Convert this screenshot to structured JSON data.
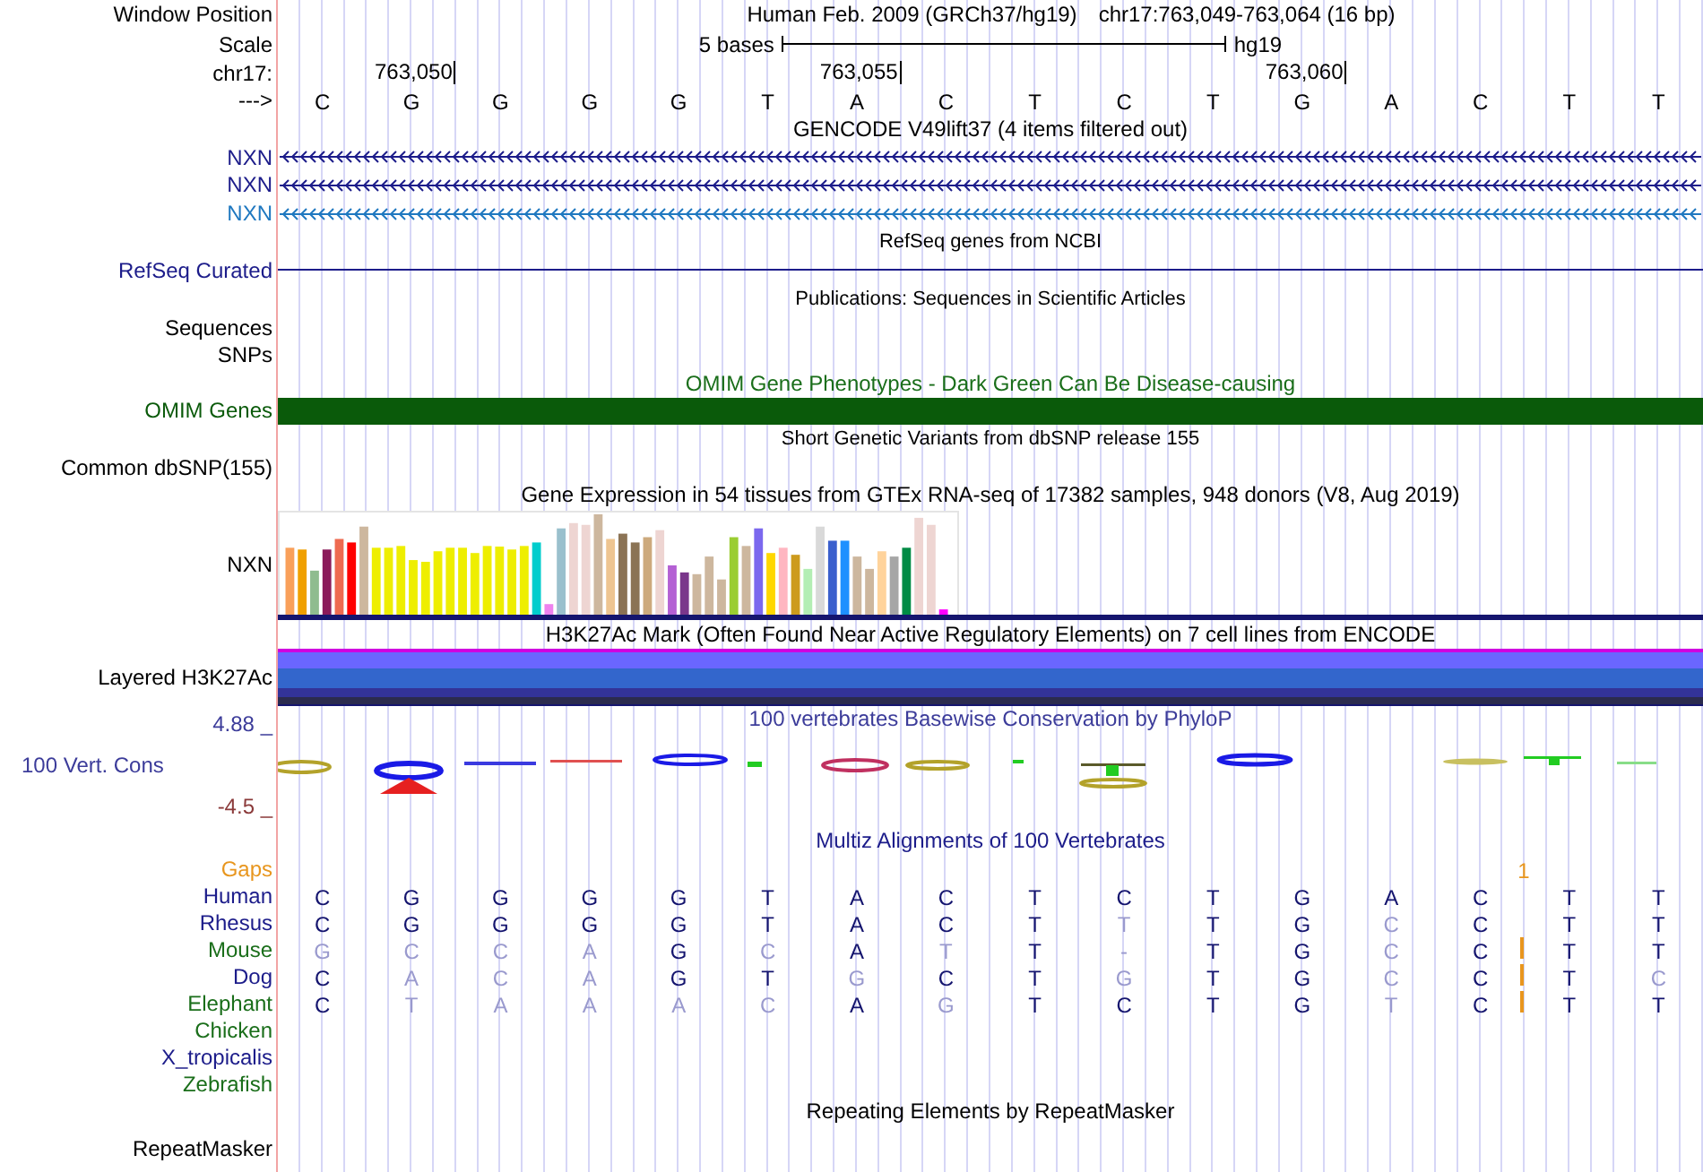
{
  "rows": [
    {
      "kind": "header",
      "label": "Window Position",
      "texts": [
        "Human Feb. 2009 (GRCh37/hg19)",
        "chr17:763,049-763,064 (16 bp)"
      ]
    },
    {
      "kind": "scale",
      "label": "Scale",
      "text": "5 bases",
      "assembly": "hg19"
    },
    {
      "kind": "ruler",
      "label": "chr17:",
      "ticks": [
        "763,050",
        "763,055",
        "763,060"
      ]
    },
    {
      "kind": "bases",
      "label": "--->",
      "bases": [
        "C",
        "G",
        "G",
        "G",
        "G",
        "T",
        "A",
        "C",
        "T",
        "C",
        "T",
        "G",
        "A",
        "C",
        "T",
        "T"
      ]
    },
    {
      "kind": "title",
      "text": "GENCODE V49lift37 (4 items filtered out)"
    },
    {
      "kind": "gene",
      "label": "NXN",
      "color": "#1c1c8a"
    },
    {
      "kind": "gene",
      "label": "NXN",
      "color": "#1c1c8a"
    },
    {
      "kind": "gene",
      "label": "NXN",
      "color": "#1f78c0"
    },
    {
      "kind": "note",
      "text": "RefSeq genes from NCBI"
    },
    {
      "kind": "line",
      "label": "RefSeq Curated",
      "color": "#1c1c8a"
    },
    {
      "kind": "note",
      "text": "Publications: Sequences in Scientific Articles"
    },
    {
      "kind": "empty",
      "label": "Sequences"
    },
    {
      "kind": "empty",
      "label": "SNPs"
    },
    {
      "kind": "title",
      "text": "OMIM Gene Phenotypes - Dark Green Can Be Disease-causing",
      "color": "#1a6e1a"
    },
    {
      "kind": "bar",
      "label": "OMIM Genes",
      "color": "#0a5a0a"
    },
    {
      "kind": "note",
      "text": "Short Genetic Variants from dbSNP release 155"
    },
    {
      "kind": "empty",
      "label": "Common dbSNP(155)"
    },
    {
      "kind": "title",
      "text": "Gene Expression in 54 tissues from GTEx RNA-seq of 17382 samples, 948 donors (V8, Aug 2019)"
    },
    {
      "kind": "expression",
      "label": "NXN"
    },
    {
      "kind": "title",
      "text": "H3K27Ac Mark (Often Found Near Active Regulatory Elements) on 7 cell lines from ENCODE"
    },
    {
      "kind": "layered",
      "label": "Layered H3K27Ac"
    },
    {
      "kind": "conservation",
      "label": "100 Vert. Cons",
      "max": "4.88 _",
      "min": "-4.5 _",
      "title": "100 vertebrates Basewise Conservation by PhyloP"
    },
    {
      "kind": "title",
      "text": "Multiz Alignments of 100 Vertebrates",
      "color": "#1c1c8a"
    },
    {
      "kind": "gaps",
      "label": "Gaps",
      "mark": "1",
      "color": "#e8961e"
    },
    {
      "kind": "species",
      "label": "Human",
      "color": "#1c1c8a",
      "bases": [
        {
          "b": "C",
          "match": true
        },
        {
          "b": "G",
          "match": true
        },
        {
          "b": "G",
          "match": true
        },
        {
          "b": "G",
          "match": true
        },
        {
          "b": "G",
          "match": true
        },
        {
          "b": "T",
          "match": true
        },
        {
          "b": "A",
          "match": true
        },
        {
          "b": "C",
          "match": true
        },
        {
          "b": "T",
          "match": true
        },
        {
          "b": "C",
          "match": true
        },
        {
          "b": "T",
          "match": true
        },
        {
          "b": "G",
          "match": true
        },
        {
          "b": "A",
          "match": true
        },
        {
          "b": "C",
          "match": true
        },
        {
          "b": "T",
          "match": true
        },
        {
          "b": "T",
          "match": true
        }
      ]
    },
    {
      "kind": "species",
      "label": "Rhesus",
      "color": "#1c1c8a",
      "bases": [
        {
          "b": "C",
          "match": true
        },
        {
          "b": "G",
          "match": true
        },
        {
          "b": "G",
          "match": true
        },
        {
          "b": "G",
          "match": true
        },
        {
          "b": "G",
          "match": true
        },
        {
          "b": "T",
          "match": true
        },
        {
          "b": "A",
          "match": true
        },
        {
          "b": "C",
          "match": true
        },
        {
          "b": "T",
          "match": true
        },
        {
          "b": "T",
          "match": false
        },
        {
          "b": "T",
          "match": true
        },
        {
          "b": "G",
          "match": true
        },
        {
          "b": "C",
          "match": false
        },
        {
          "b": "C",
          "match": true
        },
        {
          "b": "T",
          "match": true
        },
        {
          "b": "T",
          "match": true
        }
      ]
    },
    {
      "kind": "species",
      "label": "Mouse",
      "color": "#1a6e1a",
      "insertion": true,
      "bases": [
        {
          "b": "G",
          "match": false
        },
        {
          "b": "C",
          "match": false
        },
        {
          "b": "C",
          "match": false
        },
        {
          "b": "A",
          "match": false
        },
        {
          "b": "G",
          "match": true
        },
        {
          "b": "C",
          "match": false
        },
        {
          "b": "A",
          "match": true
        },
        {
          "b": "T",
          "match": false
        },
        {
          "b": "T",
          "match": true
        },
        {
          "b": "-",
          "match": false
        },
        {
          "b": "T",
          "match": true
        },
        {
          "b": "G",
          "match": true
        },
        {
          "b": "C",
          "match": false
        },
        {
          "b": "C",
          "match": true
        },
        {
          "b": "T",
          "match": true
        },
        {
          "b": "T",
          "match": true
        }
      ]
    },
    {
      "kind": "species",
      "label": "Dog",
      "color": "#1c1c8a",
      "insertion": true,
      "bases": [
        {
          "b": "C",
          "match": true
        },
        {
          "b": "A",
          "match": false
        },
        {
          "b": "C",
          "match": false
        },
        {
          "b": "A",
          "match": false
        },
        {
          "b": "G",
          "match": true
        },
        {
          "b": "T",
          "match": true
        },
        {
          "b": "G",
          "match": false
        },
        {
          "b": "C",
          "match": true
        },
        {
          "b": "T",
          "match": true
        },
        {
          "b": "G",
          "match": false
        },
        {
          "b": "T",
          "match": true
        },
        {
          "b": "G",
          "match": true
        },
        {
          "b": "C",
          "match": false
        },
        {
          "b": "C",
          "match": true
        },
        {
          "b": "T",
          "match": true
        },
        {
          "b": "C",
          "match": false
        }
      ]
    },
    {
      "kind": "species",
      "label": "Elephant",
      "color": "#1a6e1a",
      "insertion": true,
      "bases": [
        {
          "b": "C",
          "match": true
        },
        {
          "b": "T",
          "match": false
        },
        {
          "b": "A",
          "match": false
        },
        {
          "b": "A",
          "match": false
        },
        {
          "b": "A",
          "match": false
        },
        {
          "b": "C",
          "match": false
        },
        {
          "b": "A",
          "match": true
        },
        {
          "b": "G",
          "match": false
        },
        {
          "b": "T",
          "match": true
        },
        {
          "b": "C",
          "match": true
        },
        {
          "b": "T",
          "match": true
        },
        {
          "b": "G",
          "match": true
        },
        {
          "b": "T",
          "match": false
        },
        {
          "b": "C",
          "match": true
        },
        {
          "b": "T",
          "match": true
        },
        {
          "b": "T",
          "match": true
        }
      ]
    },
    {
      "kind": "species",
      "label": "Chicken",
      "color": "#1a6e1a"
    },
    {
      "kind": "species",
      "label": "X_tropicalis",
      "color": "#1c1c8a"
    },
    {
      "kind": "species",
      "label": "Zebrafish",
      "color": "#1a6e1a"
    },
    {
      "kind": "title",
      "text": "Repeating Elements by RepeatMasker"
    },
    {
      "kind": "empty",
      "label": "RepeatMasker"
    }
  ]
}
